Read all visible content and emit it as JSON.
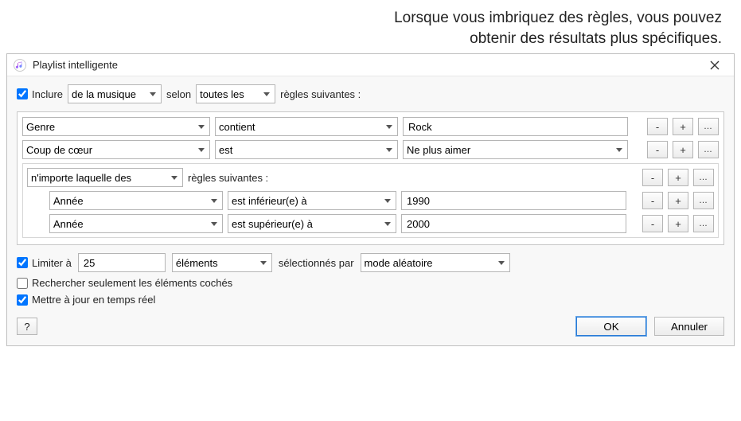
{
  "caption": {
    "line1": "Lorsque vous imbriquez des règles, vous pouvez",
    "line2": "obtenir des résultats plus spécifiques."
  },
  "titlebar": {
    "title": "Playlist intelligente"
  },
  "include": {
    "checkbox_label": "Inclure",
    "source": "de la musique",
    "selon_label": "selon",
    "match": "toutes les",
    "tail": "règles suivantes :"
  },
  "rules": [
    {
      "attr": "Genre",
      "op": "contient",
      "value": "Rock",
      "value_type": "text"
    },
    {
      "attr": "Coup de cœur",
      "op": "est",
      "value": "Ne plus aimer",
      "value_type": "select"
    }
  ],
  "nested": {
    "match": "n'importe laquelle des",
    "tail": "règles suivantes :",
    "rules": [
      {
        "attr": "Année",
        "op": "est inférieur(e) à",
        "value": "1990"
      },
      {
        "attr": "Année",
        "op": "est supérieur(e) à",
        "value": "2000"
      }
    ]
  },
  "limit": {
    "checkbox_label": "Limiter à",
    "count": "25",
    "unit": "éléments",
    "by_label": "sélectionnés par",
    "by": "mode aléatoire"
  },
  "opt_checked_only": "Rechercher seulement les éléments cochés",
  "opt_live_update": "Mettre à jour en temps réel",
  "buttons": {
    "help": "?",
    "ok": "OK",
    "cancel": "Annuler",
    "minus": "-",
    "plus": "+",
    "dots": "…"
  }
}
